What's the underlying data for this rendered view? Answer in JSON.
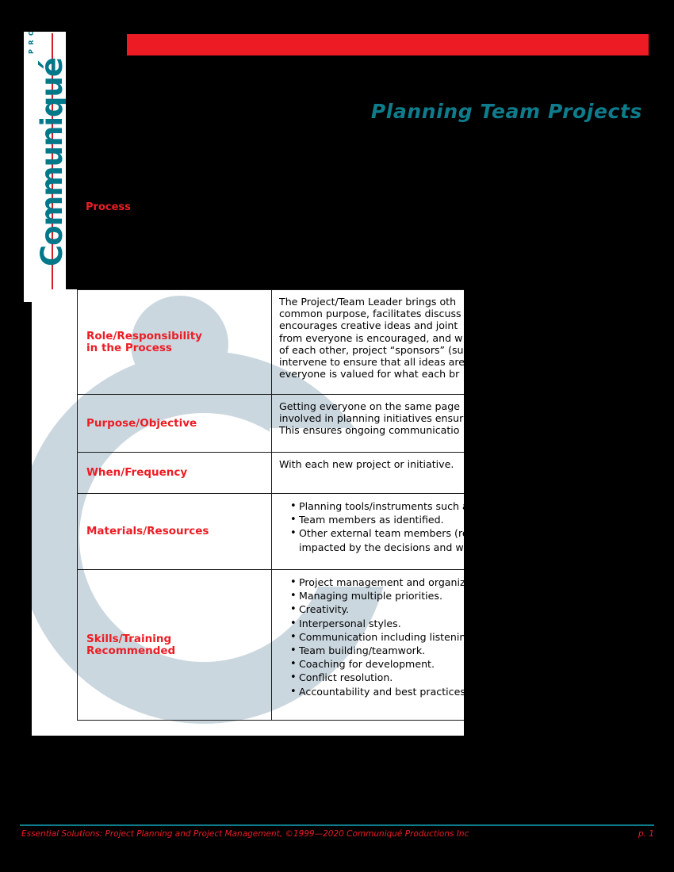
{
  "document": {
    "title": "Planning Team Projects",
    "section_label": "Process"
  },
  "logo": {
    "wordmark": "Communiqué",
    "tagline": "PRODUCTIONS",
    "teal": "#00788A",
    "red": "#D41B24"
  },
  "banner": {
    "color": "#ED1C24"
  },
  "table": {
    "rows": [
      {
        "label": "Role/Responsibility\nin the Process",
        "type": "paragraph",
        "body": "The Project/Team Leader brings oth\ncommon purpose, facilitates discuss\nencourages creative ideas and joint \nfrom everyone is encouraged, and w\nof each other, project “sponsors” (su\nintervene to ensure that all ideas are\neveryone is valued for what each br"
      },
      {
        "label": "Purpose/Objective",
        "type": "paragraph",
        "body": "Getting everyone on the same page\ninvolved in planning initiatives ensur\nThis ensures ongoing communicatio"
      },
      {
        "label": "When/Frequency",
        "type": "paragraph",
        "body": "With each new project or initiative."
      },
      {
        "label": "Materials/Resources",
        "type": "list",
        "items": [
          "Planning tools/instruments such as",
          "Team members as identified.",
          "Other external team members (rep\n  impacted by the decisions and wo"
        ]
      },
      {
        "label": "Skills/Training\nRecommended",
        "type": "list",
        "items": [
          "Project management and organiza",
          "Managing multiple priorities.",
          "Creativity.",
          "Interpersonal styles.",
          "Communication including listening",
          "Team building/teamwork.",
          "Coaching for development.",
          "Conflict resolution.",
          "Accountability and best practices."
        ]
      }
    ]
  },
  "footer": {
    "text": "Essential Solutions:  Project Planning and Project Management,  ©1999—2020 Communiqué Productions Inc",
    "page": "p. 1",
    "rule_color": "#0E7C8C"
  }
}
